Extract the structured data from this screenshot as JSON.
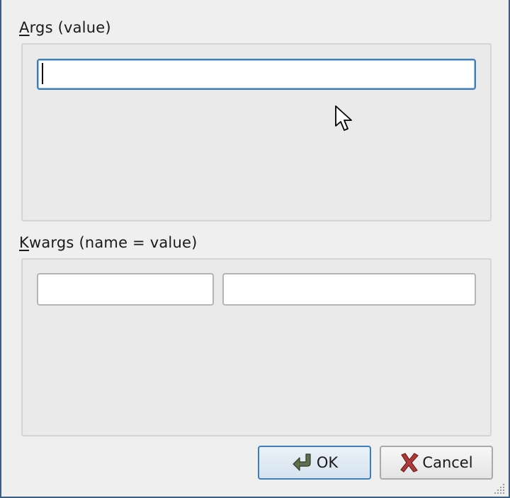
{
  "args_section": {
    "label_mnemonic": "A",
    "label_rest": "rgs (value)",
    "value_input": {
      "value": "",
      "placeholder": ""
    }
  },
  "kwargs_section": {
    "label_mnemonic": "K",
    "label_rest": "wargs (name = value)",
    "name_input": {
      "value": "",
      "placeholder": ""
    },
    "value_input": {
      "value": "",
      "placeholder": ""
    }
  },
  "buttons": {
    "ok_label": "OK",
    "ok_icon": "ok-check-arrow-icon",
    "cancel_label": "Cancel",
    "cancel_icon": "cancel-x-icon"
  },
  "colors": {
    "focus_border": "#3d7eb8",
    "ok_icon_color": "#5f6e4e",
    "cancel_icon_color": "#b03a3a"
  }
}
